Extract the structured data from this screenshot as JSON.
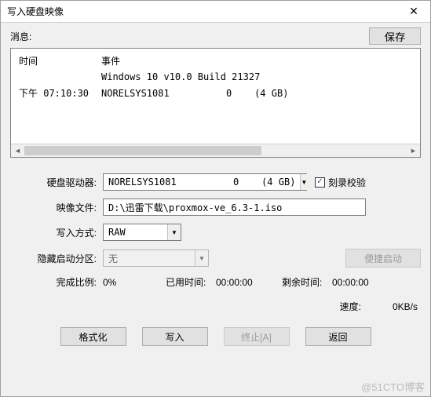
{
  "window": {
    "title": "写入硬盘映像"
  },
  "info": {
    "label": "消息:",
    "save_btn": "保存"
  },
  "log": {
    "col_time": "时间",
    "col_event": "事件",
    "rows": [
      {
        "time": "",
        "event": "Windows 10 v10.0 Build 21327"
      },
      {
        "time": "下午 07:10:30",
        "event": "NORELSYS1081          0    (4 GB)"
      }
    ]
  },
  "form": {
    "drive_label": "硬盘驱动器:",
    "drive_value": "NORELSYS1081          0    (4 GB)",
    "verify_label": "刻录校验",
    "image_label": "映像文件:",
    "image_value": "D:\\迅雷下载\\proxmox-ve_6.3-1.iso",
    "mode_label": "写入方式:",
    "mode_value": "RAW",
    "hidden_label": "隐藏启动分区:",
    "hidden_value": "无",
    "boot_btn": "便捷启动"
  },
  "stats": {
    "progress_label": "完成比例:",
    "progress_value": "0%",
    "elapsed_label": "已用时间:",
    "elapsed_value": "00:00:00",
    "remain_label": "剩余时间:",
    "remain_value": "00:00:00",
    "speed_label": "速度:",
    "speed_value": "0KB/s"
  },
  "buttons": {
    "format": "格式化",
    "write": "写入",
    "abort": "终止[A]",
    "back": "返回"
  },
  "watermark": "@51CTO博客"
}
